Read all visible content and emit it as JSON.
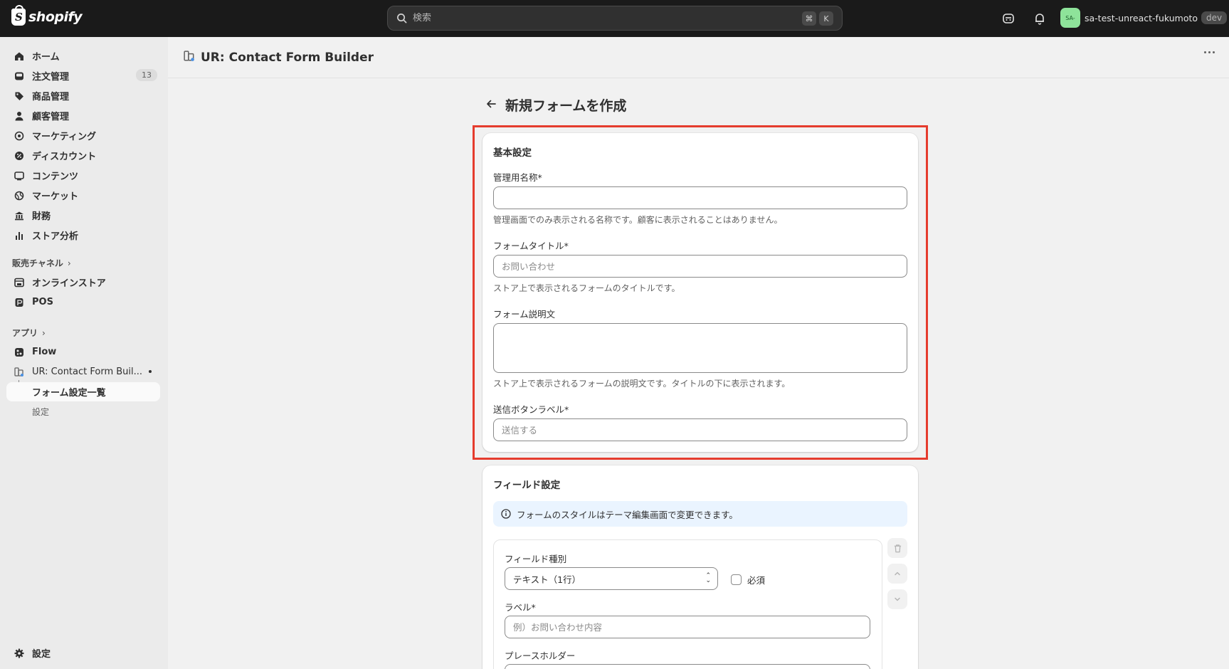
{
  "topbar": {
    "brand": "shopify",
    "search_placeholder": "検索",
    "shortcut_cmd": "⌘",
    "shortcut_key": "K",
    "store_avatar": "SA-",
    "store_name": "sa-test-unreact-fukumoto",
    "store_badge": "dev"
  },
  "sidebar": {
    "items": [
      {
        "label": "ホーム",
        "icon": "home-icon"
      },
      {
        "label": "注文管理",
        "icon": "inbox-icon",
        "count": "13"
      },
      {
        "label": "商品管理",
        "icon": "tag-icon"
      },
      {
        "label": "顧客管理",
        "icon": "person-icon"
      },
      {
        "label": "マーケティング",
        "icon": "target-icon"
      },
      {
        "label": "ディスカウント",
        "icon": "discount-icon"
      },
      {
        "label": "コンテンツ",
        "icon": "content-icon"
      },
      {
        "label": "マーケット",
        "icon": "globe-icon"
      },
      {
        "label": "財務",
        "icon": "bank-icon"
      },
      {
        "label": "ストア分析",
        "icon": "chart-icon"
      }
    ],
    "sales_channels_title": "販売チャネル",
    "channels": [
      {
        "label": "オンラインストア",
        "icon": "store-icon"
      },
      {
        "label": "POS",
        "icon": "pos-icon"
      }
    ],
    "apps_title": "アプリ",
    "apps": [
      {
        "label": "Flow",
        "icon": "flow-icon"
      },
      {
        "label": "UR: Contact Form Buil...",
        "icon": "app-icon"
      }
    ],
    "app_subitems": [
      "フォーム設定一覧",
      "設定"
    ],
    "settings_label": "設定"
  },
  "app_header": {
    "title": "UR: Contact Form Builder"
  },
  "page": {
    "title": "新規フォームを作成",
    "basic": {
      "title": "基本設定",
      "admin_name_label": "管理用名称*",
      "admin_name_value": "",
      "admin_name_help": "管理画面でのみ表示される名称です。顧客に表示されることはありません。",
      "form_title_label": "フォームタイトル*",
      "form_title_placeholder": "お問い合わせ",
      "form_title_help": "ストア上で表示されるフォームのタイトルです。",
      "desc_label": "フォーム説明文",
      "desc_help": "ストア上で表示されるフォームの説明文です。タイトルの下に表示されます。",
      "submit_label": "送信ボタンラベル*",
      "submit_placeholder": "送信する"
    },
    "fields": {
      "title": "フィールド設定",
      "banner": "フォームのスタイルはテーマ編集画面で変更できます。",
      "type_label": "フィールド種別",
      "type_value": "テキスト（1行）",
      "required_label": "必須",
      "label_label": "ラベル*",
      "label_placeholder": "例）お問い合わせ内容",
      "placeholder_label": "プレースホルダー"
    }
  },
  "colors": {
    "highlight": "#e53c2e",
    "topbar": "#1a1a1a",
    "avatar": "#8ee39a"
  }
}
